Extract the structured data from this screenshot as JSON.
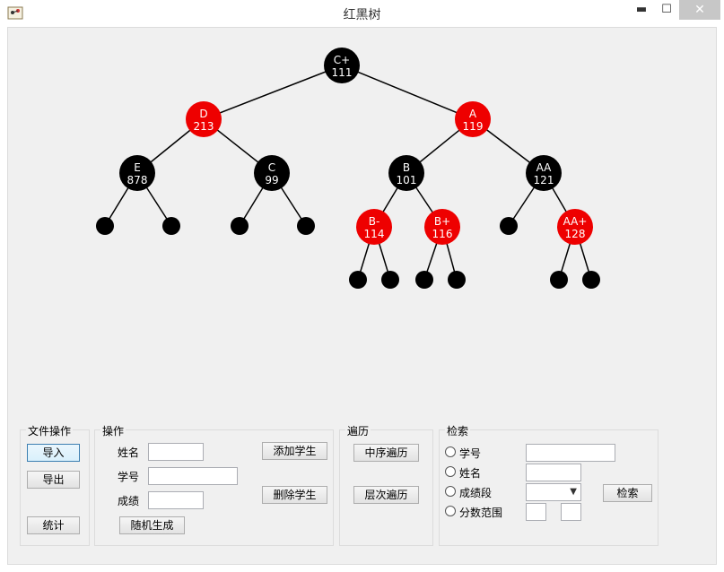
{
  "window": {
    "title": "红黑树",
    "min_glyph": "▬",
    "max_glyph": "☐",
    "close_glyph": "✕"
  },
  "tree": {
    "nodes": [
      {
        "id": "n-cplus",
        "name": "C+",
        "value": "111",
        "color": "black"
      },
      {
        "id": "n-d",
        "name": "D",
        "value": "213",
        "color": "red"
      },
      {
        "id": "n-a",
        "name": "A",
        "value": "119",
        "color": "red"
      },
      {
        "id": "n-e",
        "name": "E",
        "value": "878",
        "color": "black"
      },
      {
        "id": "n-c",
        "name": "C",
        "value": "99",
        "color": "black"
      },
      {
        "id": "n-b",
        "name": "B",
        "value": "101",
        "color": "black"
      },
      {
        "id": "n-aa",
        "name": "AA",
        "value": "121",
        "color": "black"
      },
      {
        "id": "n-bminus",
        "name": "B-",
        "value": "114",
        "color": "red"
      },
      {
        "id": "n-bplus",
        "name": "B+",
        "value": "116",
        "color": "red"
      },
      {
        "id": "n-aaplus",
        "name": "AA+",
        "value": "128",
        "color": "red"
      }
    ],
    "colors": {
      "red": "#ee0000",
      "black": "#000000",
      "text": "#ffffff",
      "edge": "#000000"
    }
  },
  "file_ops": {
    "title": "文件操作",
    "import": "导入",
    "export": "导出",
    "stats": "统计"
  },
  "ops": {
    "title": "操作",
    "name_label": "姓名",
    "id_label": "学号",
    "score_label": "成绩",
    "add": "添加学生",
    "delete": "删除学生",
    "random": "随机生成",
    "name_value": "",
    "id_value": "",
    "score_value": ""
  },
  "traverse": {
    "title": "遍历",
    "inorder": "中序遍历",
    "levelorder": "层次遍历"
  },
  "search": {
    "title": "检索",
    "opt_id": "学号",
    "opt_name": "姓名",
    "opt_segment": "成绩段",
    "opt_range": "分数范围",
    "search_btn": "检索",
    "id_value": "",
    "name_value": "",
    "segment_selected": "",
    "range_from": "",
    "range_to": ""
  }
}
